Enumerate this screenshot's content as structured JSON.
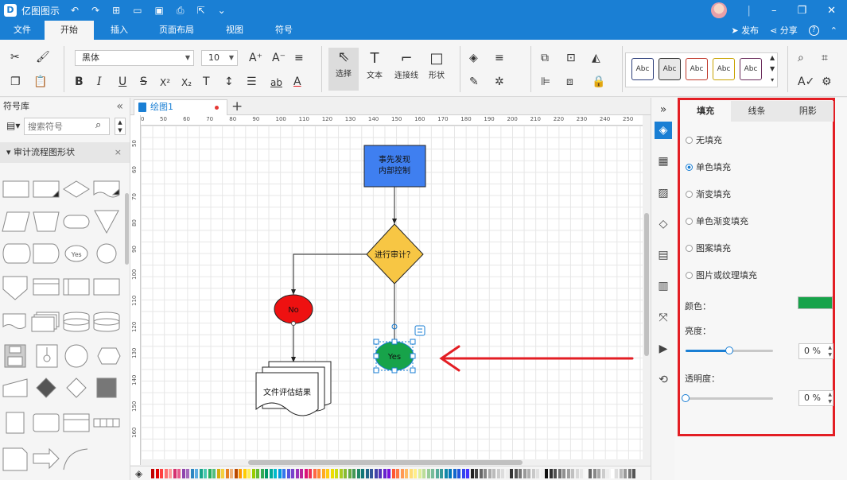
{
  "titlebar": {
    "app_title": "亿图图示",
    "quick_undo": "↶",
    "quick_redo": "↷",
    "quick_new": "⊞",
    "quick_open": "▭",
    "quick_save": "▣",
    "quick_print": "⎙",
    "quick_export": "⇱",
    "quick_more": "⌄",
    "min": "–",
    "restore": "❐",
    "close": "✕"
  },
  "menubar": {
    "items": [
      "文件",
      "开始",
      "插入",
      "页面布局",
      "视图",
      "符号"
    ],
    "active": 1,
    "publish": "发布",
    "share": "分享",
    "help": "?"
  },
  "ribbon": {
    "font_name": "黑体",
    "font_size": "10",
    "tools": {
      "select": "选择",
      "text": "文本",
      "connector": "连接线",
      "shape": "形状"
    },
    "style_samples": [
      "Abc",
      "Abc",
      "Abc",
      "Abc",
      "Abc"
    ],
    "style_colors": [
      "#2c3e7a",
      "#333333",
      "#c0392b",
      "#c8a200",
      "#6b2d5c"
    ]
  },
  "library": {
    "title": "符号库",
    "search_placeholder": "搜索符号",
    "category": "审计流程图形状",
    "yes_shape_label": "Yes"
  },
  "document": {
    "tab_name": "绘图1"
  },
  "ruler": {
    "h_ticks": [
      "0",
      "50",
      "60",
      "70",
      "80",
      "90",
      "100",
      "110",
      "120",
      "130",
      "140",
      "150",
      "160",
      "170",
      "180",
      "190",
      "200",
      "210",
      "220",
      "230",
      "240",
      "250"
    ],
    "v_ticks": [
      "50",
      "60",
      "70",
      "80",
      "90",
      "100",
      "110",
      "120",
      "130",
      "140",
      "150",
      "160"
    ]
  },
  "diagram": {
    "process_label_1": "事先发现",
    "process_label_2": "内部控制",
    "decision_label": "进行审计？",
    "no_label": "No",
    "yes_label": "Yes",
    "document_label": "文件评估结果",
    "process_color": "#3f7ff0",
    "decision_color": "#f7c644",
    "no_color": "#ee1111",
    "yes_color": "#17a34a",
    "arrow_color": "#e31e24"
  },
  "properties": {
    "tabs": [
      "填充",
      "线条",
      "阴影"
    ],
    "active_tab": 0,
    "fill_options": [
      "无填充",
      "单色填充",
      "渐变填充",
      "单色渐变填充",
      "图案填充",
      "图片或纹理填充"
    ],
    "selected_option": 1,
    "color_label": "颜色：",
    "color_value": "#17a34a",
    "brightness_label": "亮度：",
    "brightness_value": "0 %",
    "brightness_level": 0.5,
    "transparency_label": "透明度：",
    "transparency_value": "0 %",
    "transparency_level": 0
  },
  "palette_colors": [
    "#c00000",
    "#e00000",
    "#ff4040",
    "#ff7070",
    "#ff9999",
    "#d4306e",
    "#e85a8c",
    "#8e44ad",
    "#a569bd",
    "#2e86c1",
    "#5dade2",
    "#17a589",
    "#48c9b0",
    "#27ae60",
    "#52be80",
    "#d4ac0d",
    "#f4d03f",
    "#e67e22",
    "#f0b27a",
    "#ba4a00",
    "#ff9900",
    "#ffcc00",
    "#ffee55",
    "#99cc00",
    "#66bb33",
    "#33aa55",
    "#009966",
    "#00aa99",
    "#00bbcc",
    "#0099dd",
    "#3377ee",
    "#5555dd",
    "#7744cc",
    "#9933bb",
    "#bb2299",
    "#dd1177",
    "#ee3355",
    "#ff6644",
    "#ff8833",
    "#ffaa22",
    "#ffcc11",
    "#eedd00",
    "#ccdd11",
    "#aacc22",
    "#88bb33",
    "#66aa44",
    "#449955",
    "#228866",
    "#117777",
    "#226688",
    "#335599",
    "#4444aa",
    "#5533bb",
    "#6622cc",
    "#7711dd",
    "#ff5533",
    "#ff7744",
    "#ff9955",
    "#ffbb66",
    "#ffdd77",
    "#ffee88",
    "#ddee99",
    "#bbdd99",
    "#99cc99",
    "#77bb99",
    "#55aa99",
    "#339999",
    "#1188aa",
    "#0077bb",
    "#1166cc",
    "#2255dd",
    "#3344ee",
    "#4433ff",
    "#222222",
    "#444444",
    "#666666",
    "#888888",
    "#aaaaaa",
    "#bbbbbb",
    "#cccccc",
    "#dddddd",
    "#eeeeee",
    "#333333",
    "#555555",
    "#777777",
    "#999999",
    "#b0b0b0",
    "#c8c8c8",
    "#e0e0e0",
    "#f0f0f0",
    "#101010",
    "#303030",
    "#505050",
    "#707070",
    "#909090",
    "#a0a0a0",
    "#c0c0c0",
    "#d8d8d8",
    "#e8e8e8",
    "#f8f8f8",
    "#666666",
    "#888888",
    "#aaaaaa",
    "#cccccc",
    "#eeeeee",
    "#ffffff",
    "#dddddd",
    "#bbbbbb",
    "#999999",
    "#777777",
    "#555555"
  ]
}
